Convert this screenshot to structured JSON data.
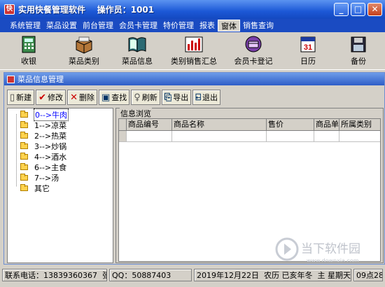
{
  "window": {
    "title": "实用快餐管理软件",
    "operator": "操作员：1001"
  },
  "menu": [
    "系统管理",
    "菜品设置",
    "前台管理",
    "会员卡管理",
    "特价管理",
    "报表",
    "窗体",
    "销售查询"
  ],
  "toolbar": [
    {
      "label": "收银",
      "icon": "cash-register-icon"
    },
    {
      "label": "菜品类别",
      "icon": "category-icon"
    },
    {
      "label": "菜品信息",
      "icon": "book-icon"
    },
    {
      "label": "类别销售汇总",
      "icon": "bar-chart-icon"
    },
    {
      "label": "会员卡登记",
      "icon": "member-card-icon"
    },
    {
      "label": "日历",
      "icon": "calendar-icon"
    },
    {
      "label": "备份",
      "icon": "backup-disk-icon"
    }
  ],
  "child": {
    "title": "菜品信息管理",
    "buttons": [
      {
        "label": "新建"
      },
      {
        "label": "修改"
      },
      {
        "label": "删除"
      },
      {
        "label": "查找"
      },
      {
        "label": "刷新"
      },
      {
        "label": "导出"
      },
      {
        "label": "退出"
      }
    ],
    "tree": [
      "0-->牛肉",
      "1-->凉菜",
      "2-->热菜",
      "3-->炒锅",
      "4-->酒水",
      "6-->主食",
      "7-->汤",
      "其它"
    ],
    "group_label": "信息浏览",
    "columns": [
      "商品编号",
      "商品名称",
      "售价",
      "商品单",
      "所属类别"
    ]
  },
  "status": {
    "phone": "联系电话：13839360367  张",
    "qq": "QQ：50887403",
    "date": "2019年12月22日  农历 已亥年冬  主 星期天",
    "time": "09点28"
  },
  "watermark": {
    "big": "当下软件园",
    "small": "www.downxia.com"
  },
  "calendar_day": "31"
}
